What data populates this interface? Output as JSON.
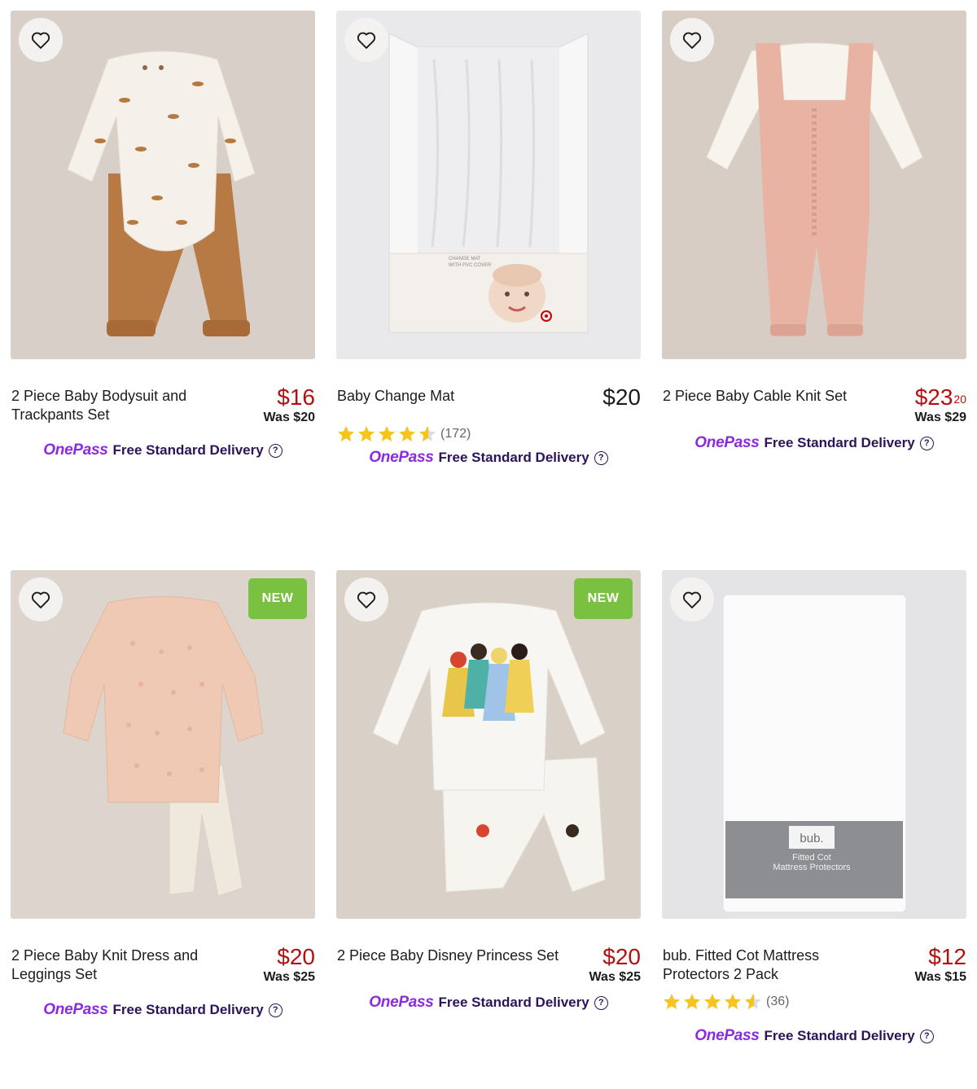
{
  "colors": {
    "sale_price": "#b3100f",
    "onepass_purple": "#8a2be2",
    "delivery_text": "#2c135a",
    "new_badge": "#7ac142",
    "star": "#f6c31f"
  },
  "products": [
    {
      "title": "2 Piece Baby Bodysuit and Trackpants Set",
      "price": "$16",
      "price_cents": "",
      "was": "Was $20",
      "badge": "",
      "rating_count": "",
      "onepass_logo": "OnePass",
      "delivery": "Free Standard Delivery",
      "help_icon": "question-circle-icon",
      "wishlist_icon": "heart-icon"
    },
    {
      "title": "Baby Change Mat",
      "price": "$20",
      "price_cents": "",
      "was": "",
      "badge": "",
      "rating": 4.5,
      "rating_count": "(172)",
      "onepass_logo": "OnePass",
      "delivery": "Free Standard Delivery",
      "help_icon": "question-circle-icon",
      "wishlist_icon": "heart-icon",
      "packaging_text": "CHANGE MAT WITH PVC COVER"
    },
    {
      "title": "2 Piece Baby Cable Knit Set",
      "price": "$23",
      "price_cents": "20",
      "was": "Was $29",
      "badge": "",
      "rating_count": "",
      "onepass_logo": "OnePass",
      "delivery": "Free Standard Delivery",
      "help_icon": "question-circle-icon",
      "wishlist_icon": "heart-icon"
    },
    {
      "title": "2 Piece Baby Knit Dress and Leggings Set",
      "price": "$20",
      "price_cents": "",
      "was": "Was $25",
      "badge": "NEW",
      "rating_count": "",
      "onepass_logo": "OnePass",
      "delivery": "Free Standard Delivery",
      "help_icon": "question-circle-icon",
      "wishlist_icon": "heart-icon"
    },
    {
      "title": "2 Piece Baby Disney Princess Set",
      "price": "$20",
      "price_cents": "",
      "was": "Was $25",
      "badge": "NEW",
      "rating_count": "",
      "onepass_logo": "OnePass",
      "delivery": "Free Standard Delivery",
      "help_icon": "question-circle-icon",
      "wishlist_icon": "heart-icon"
    },
    {
      "title": "bub. Fitted Cot Mattress Protectors 2 Pack",
      "price": "$12",
      "price_cents": "",
      "was": "Was $15",
      "badge": "",
      "rating": 4.5,
      "rating_count": "(36)",
      "onepass_logo": "OnePass",
      "delivery": "Free Standard Delivery",
      "help_icon": "question-circle-icon",
      "wishlist_icon": "heart-icon",
      "packaging_brand": "bub.",
      "packaging_text": "Fitted Cot Mattress Protectors"
    }
  ]
}
